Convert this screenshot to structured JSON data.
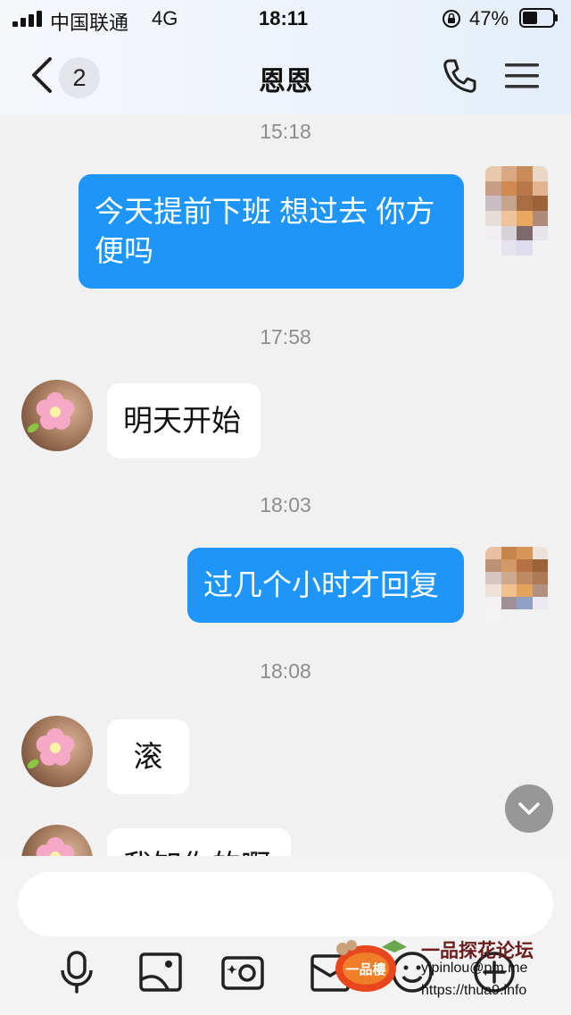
{
  "status_bar": {
    "carrier": "中国联通",
    "network": "4G",
    "time": "18:11",
    "battery_percent": "47%"
  },
  "header": {
    "title": "恩恩",
    "back_badge": "2",
    "icons": [
      "chevron-left-icon",
      "phone-icon",
      "menu-icon"
    ]
  },
  "messages": [
    {
      "type": "timestamp",
      "text": "15:18"
    },
    {
      "type": "outgoing",
      "text": "今天提前下班 想过去 你方便吗"
    },
    {
      "type": "timestamp",
      "text": "17:58"
    },
    {
      "type": "incoming",
      "text": "明天开始"
    },
    {
      "type": "timestamp",
      "text": "18:03"
    },
    {
      "type": "outgoing",
      "text": "过几个小时才回复"
    },
    {
      "type": "timestamp",
      "text": "18:08"
    },
    {
      "type": "incoming",
      "text": "滚"
    },
    {
      "type": "incoming",
      "text": "我知你的啊"
    }
  ],
  "input": {
    "placeholder": ""
  },
  "toolbar": {
    "icons": [
      "microphone-icon",
      "image-icon",
      "camera-icon",
      "file-icon",
      "emoji-icon",
      "plus-icon"
    ]
  },
  "watermark": {
    "title": "一品探花论坛",
    "line1": "yipinlou@pm.me",
    "line2": "https://thua9.info",
    "logo_text": "一品樓"
  },
  "colors": {
    "outgoing_bubble": "#1e95f8",
    "incoming_bubble": "#ffffff",
    "background": "#f1f1f1"
  }
}
